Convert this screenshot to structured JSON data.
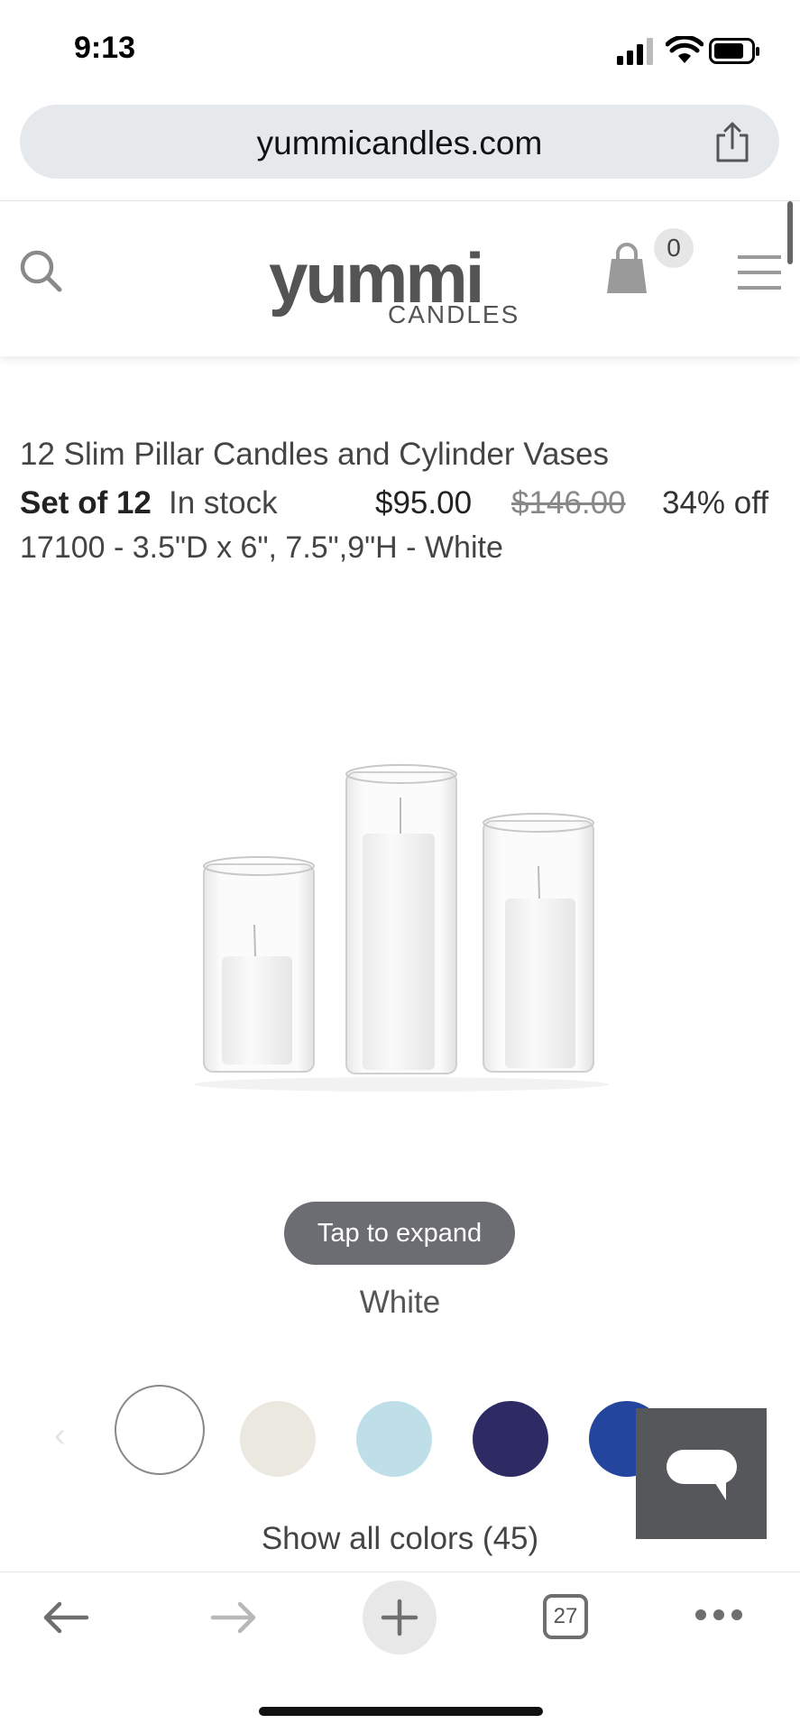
{
  "status_bar": {
    "time": "9:13"
  },
  "browser": {
    "url": "yummicandles.com",
    "tab_count": "27"
  },
  "site_header": {
    "logo_main": "yummi",
    "logo_sub": "CANDLES",
    "cart_count": "0"
  },
  "product": {
    "title": "12 Slim Pillar Candles and Cylinder Vases",
    "set_label": "Set of 12",
    "stock": "In stock",
    "price": "$95.00",
    "old_price": "$146.00",
    "discount": "34% off",
    "sku_line": "17100 - 3.5\"D x 6\", 7.5\",9\"H - White",
    "tap_to_expand": "Tap to expand",
    "selected_color": "White",
    "show_all_colors": "Show all colors (45)"
  },
  "swatches": [
    {
      "name": "white",
      "color": "#ffffff",
      "selected": true
    },
    {
      "name": "ivory",
      "color": "#ebe8df"
    },
    {
      "name": "light-blue",
      "color": "#bfdfe8"
    },
    {
      "name": "navy",
      "color": "#2d2a64"
    },
    {
      "name": "royal-blue",
      "color": "#24459e"
    }
  ],
  "icons": {
    "search": "search-icon",
    "cart": "shopping-bag-icon",
    "menu": "hamburger-icon",
    "share": "share-icon",
    "chat": "chat-icon",
    "back": "back-arrow-icon",
    "forward": "forward-arrow-icon",
    "new_tab": "plus-icon",
    "tabs": "tabs-icon",
    "more": "more-icon"
  }
}
